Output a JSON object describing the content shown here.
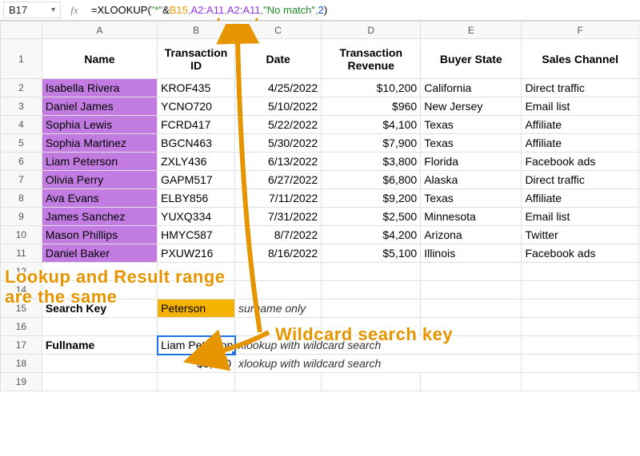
{
  "name_box": "B17",
  "fx_label": "fx",
  "formula": {
    "eq": "=",
    "fn": "XLOOKUP",
    "open": "(",
    "str": "\"*\"",
    "amp": "&",
    "r1": "B15",
    "sep": ",",
    "r2": "A2:A11",
    "r3": "A2:A11",
    "str2": "\"No match\"",
    "num": "2",
    "close": ")"
  },
  "col_headers": [
    "A",
    "B",
    "C",
    "D",
    "E",
    "F"
  ],
  "headers": [
    "Name",
    "Transaction ID",
    "Date",
    "Transaction Revenue",
    "Buyer State",
    "Sales Channel"
  ],
  "rows": [
    {
      "n": "2",
      "name": "Isabella Rivera",
      "tid": "KROF435",
      "date": "4/25/2022",
      "rev": "$10,200",
      "state": "California",
      "ch": "Direct traffic"
    },
    {
      "n": "3",
      "name": "Daniel James",
      "tid": "YCNO720",
      "date": "5/10/2022",
      "rev": "$960",
      "state": "New Jersey",
      "ch": "Email list"
    },
    {
      "n": "4",
      "name": "Sophia Lewis",
      "tid": "FCRD417",
      "date": "5/22/2022",
      "rev": "$4,100",
      "state": "Texas",
      "ch": "Affiliate"
    },
    {
      "n": "5",
      "name": "Sophia Martinez",
      "tid": "BGCN463",
      "date": "5/30/2022",
      "rev": "$7,900",
      "state": "Texas",
      "ch": "Affiliate"
    },
    {
      "n": "6",
      "name": "Liam Peterson",
      "tid": "ZXLY436",
      "date": "6/13/2022",
      "rev": "$3,800",
      "state": "Florida",
      "ch": "Facebook ads"
    },
    {
      "n": "7",
      "name": "Olivia Perry",
      "tid": "GAPM517",
      "date": "6/27/2022",
      "rev": "$6,800",
      "state": "Alaska",
      "ch": "Direct traffic"
    },
    {
      "n": "8",
      "name": "Ava Evans",
      "tid": "ELBY856",
      "date": "7/11/2022",
      "rev": "$9,200",
      "state": "Texas",
      "ch": "Affiliate"
    },
    {
      "n": "9",
      "name": "James Sanchez",
      "tid": "YUXQ334",
      "date": "7/31/2022",
      "rev": "$2,500",
      "state": "Minnesota",
      "ch": "Email list"
    },
    {
      "n": "10",
      "name": "Mason Phillips",
      "tid": "HMYC587",
      "date": "8/7/2022",
      "rev": "$4,200",
      "state": "Arizona",
      "ch": "Twitter"
    },
    {
      "n": "11",
      "name": "Daniel Baker",
      "tid": "PXUW216",
      "date": "8/16/2022",
      "rev": "$5,100",
      "state": "Illinois",
      "ch": "Facebook ads"
    }
  ],
  "row12": "12",
  "row14": "14",
  "row15": {
    "n": "15",
    "label": "Search Key",
    "value": "Peterson",
    "hint": "surname only"
  },
  "row16": "16",
  "row17": {
    "n": "17",
    "label": "Fullname",
    "value": "Liam Peterson",
    "hint": "xlookup with wildcard search"
  },
  "row18": {
    "n": "18",
    "value": "$3,800",
    "hint": "xlookup with wildcard search"
  },
  "row19": "19",
  "annotations": {
    "lookup_note": "Lookup and Result range\nare the same",
    "wildcard_note": "Wildcard search key"
  }
}
